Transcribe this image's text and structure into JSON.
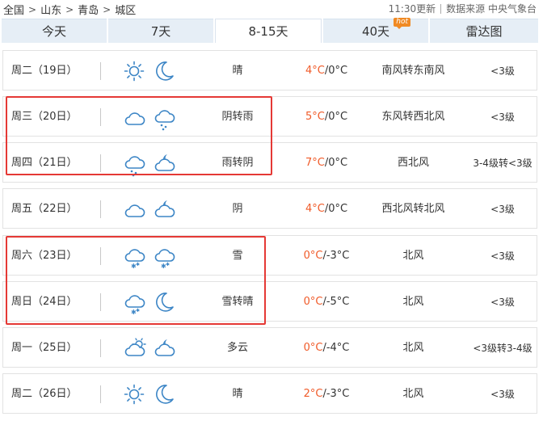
{
  "breadcrumb": {
    "items": [
      "全国",
      "山东",
      "青岛",
      "城区"
    ],
    "separator": ">"
  },
  "header": {
    "update_time": "11:30更新",
    "source": "数据来源 中央气象台"
  },
  "tabs": [
    {
      "label": "今天"
    },
    {
      "label": "7天"
    },
    {
      "label": "8-15天",
      "active": true
    },
    {
      "label": "40天",
      "badge": "hot"
    },
    {
      "label": "雷达图"
    }
  ],
  "colors": {
    "high_temp": "#f05a28",
    "highlight_border": "#e53935",
    "tab_bg": "#e6eef6",
    "icon_stroke": "#3d86c6"
  },
  "forecast": [
    {
      "day": "周二（19日）",
      "icon_day": "sun-icon",
      "icon_night": "moon-icon",
      "condition": "晴",
      "high": "4°C",
      "low": "/0°C",
      "wind": "南风转东南风",
      "level": "<3级"
    },
    {
      "day": "周三（20日）",
      "icon_day": "cloud-icon",
      "icon_night": "rain-cloud-icon",
      "condition": "阴转雨",
      "high": "5°C",
      "low": "/0°C",
      "wind": "东风转西北风",
      "level": "<3级"
    },
    {
      "day": "周四（21日）",
      "icon_day": "rain-cloud-icon",
      "icon_night": "cloud-moon-icon",
      "condition": "雨转阴",
      "high": "7°C",
      "low": "/0°C",
      "wind": "西北风",
      "level": "3-4级转<3级"
    },
    {
      "day": "周五（22日）",
      "icon_day": "cloud-icon",
      "icon_night": "cloud-moon-icon",
      "condition": "阴",
      "high": "4°C",
      "low": "/0°C",
      "wind": "西北风转北风",
      "level": "<3级"
    },
    {
      "day": "周六（23日）",
      "icon_day": "snow-cloud-icon",
      "icon_night": "snow-cloud-icon",
      "condition": "雪",
      "high": "0°C",
      "low": "/-3°C",
      "wind": "北风",
      "level": "<3级"
    },
    {
      "day": "周日（24日）",
      "icon_day": "snow-cloud-icon",
      "icon_night": "moon-icon",
      "condition": "雪转晴",
      "high": "0°C",
      "low": "/-5°C",
      "wind": "北风",
      "level": "<3级"
    },
    {
      "day": "周一（25日）",
      "icon_day": "cloud-sun-icon",
      "icon_night": "cloud-moon-icon",
      "condition": "多云",
      "high": "0°C",
      "low": "/-4°C",
      "wind": "北风",
      "level": "<3级转3-4级"
    },
    {
      "day": "周二（26日）",
      "icon_day": "sun-icon",
      "icon_night": "moon-icon",
      "condition": "晴",
      "high": "2°C",
      "low": "/-3°C",
      "wind": "北风",
      "level": "<3级"
    }
  ]
}
